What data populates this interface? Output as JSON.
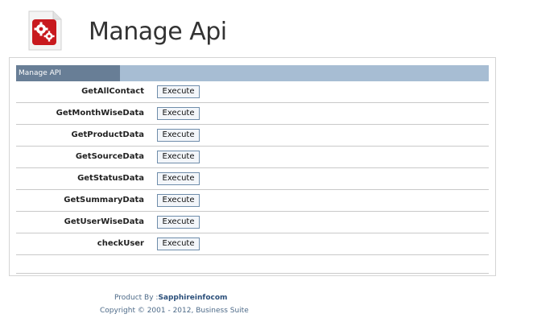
{
  "page": {
    "title": "Manage Api",
    "icon": "gears-document-icon"
  },
  "panel": {
    "header": "Manage API"
  },
  "apis": [
    {
      "name": "GetAllContact",
      "button": "Execute"
    },
    {
      "name": "GetMonthWiseData",
      "button": "Execute"
    },
    {
      "name": "GetProductData",
      "button": "Execute"
    },
    {
      "name": "GetSourceData",
      "button": "Execute"
    },
    {
      "name": "GetStatusData",
      "button": "Execute"
    },
    {
      "name": "GetSummaryData",
      "button": "Execute"
    },
    {
      "name": "GetUserWiseData",
      "button": "Execute"
    },
    {
      "name": "checkUser",
      "button": "Execute"
    }
  ],
  "footer": {
    "product_prefix": "Product By :",
    "product_name": "Sapphireinfocom",
    "copyright": "Copyright © 2001 - 2012, Business Suite"
  },
  "colors": {
    "header_tab": "#687e96",
    "header_bar": "#a7bdd3",
    "icon_red": "#c8191e"
  }
}
